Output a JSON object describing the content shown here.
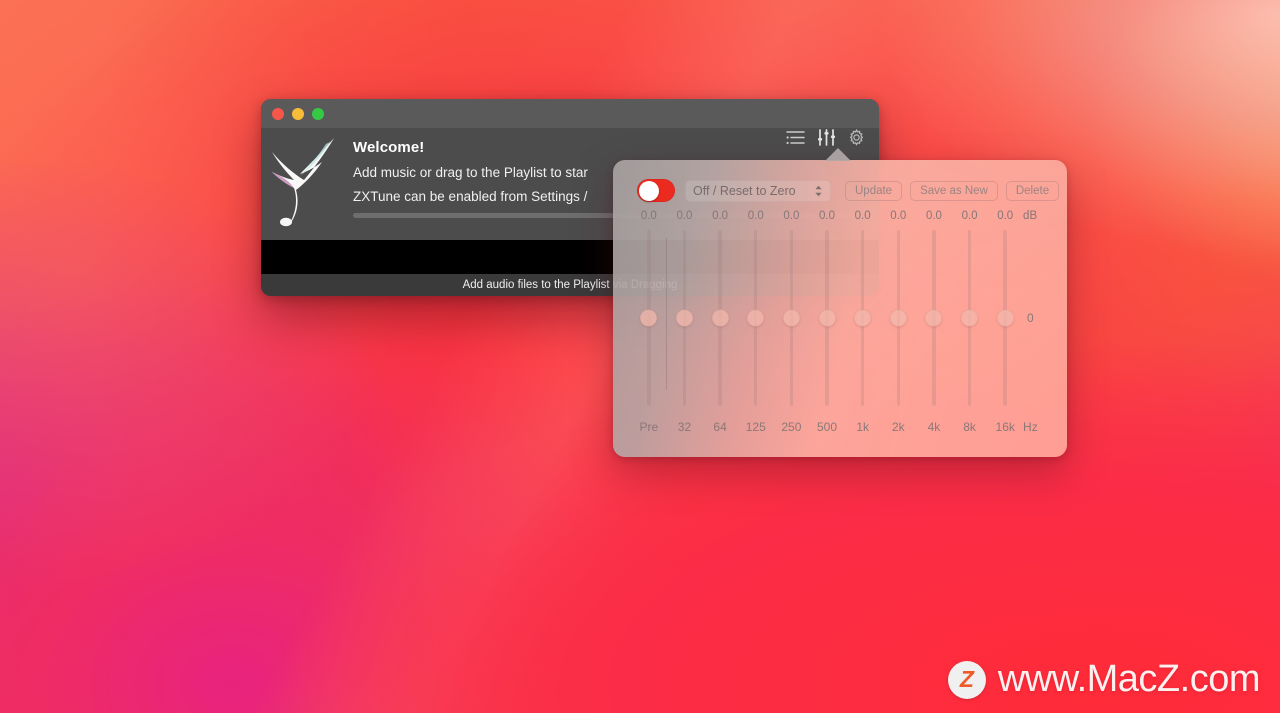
{
  "desktop": {
    "wallpaper_name": "macos-big-sur-red-gradient",
    "colors": {
      "accent_red": "#fb2d3c",
      "accent_pink": "#e8237e",
      "accent_orange": "#fa6a52",
      "accent_magenta": "#d4279a"
    }
  },
  "player_window": {
    "traffic_lights": {
      "close_label": "close",
      "minimize_label": "minimize",
      "zoom_label": "zoom",
      "close_color": "#f7564b",
      "minimize_color": "#f8bd38",
      "zoom_color": "#35c845"
    },
    "logo_name": "hummingbird-logo",
    "title": "Welcome!",
    "lines": [
      "Add music or drag to the Playlist to star",
      "ZXTune can be enabled from Settings /"
    ],
    "progress_value": 0,
    "status_text": "Add audio files to the Playlist via Dragging",
    "toolbar": [
      {
        "name": "playlist-icon",
        "label": "Playlist",
        "active": false
      },
      {
        "name": "equalizer-icon",
        "label": "Equalizer",
        "active": true
      },
      {
        "name": "settings-gear-icon",
        "label": "Settings",
        "active": false
      }
    ]
  },
  "equalizer": {
    "enabled": true,
    "toggle_color": "#ec2b20",
    "preset": {
      "selected": "Off / Reset to Zero",
      "options": [
        "Off / Reset to Zero"
      ]
    },
    "buttons": [
      {
        "name": "update-button",
        "label": "Update",
        "disabled": true
      },
      {
        "name": "save-as-new-button",
        "label": "Save as New",
        "disabled": true
      },
      {
        "name": "delete-button",
        "label": "Delete",
        "disabled": true
      }
    ],
    "unit_db": "dB",
    "unit_hz": "Hz",
    "gain_center_label": "0",
    "bands": [
      {
        "label": "Pre",
        "value": "0.0"
      },
      {
        "label": "32",
        "value": "0.0"
      },
      {
        "label": "64",
        "value": "0.0"
      },
      {
        "label": "125",
        "value": "0.0"
      },
      {
        "label": "250",
        "value": "0.0"
      },
      {
        "label": "500",
        "value": "0.0"
      },
      {
        "label": "1k",
        "value": "0.0"
      },
      {
        "label": "2k",
        "value": "0.0"
      },
      {
        "label": "4k",
        "value": "0.0"
      },
      {
        "label": "8k",
        "value": "0.0"
      },
      {
        "label": "16k",
        "value": "0.0"
      }
    ]
  },
  "watermark": {
    "badge_letter": "Z",
    "text": "www.MacZ.com"
  }
}
